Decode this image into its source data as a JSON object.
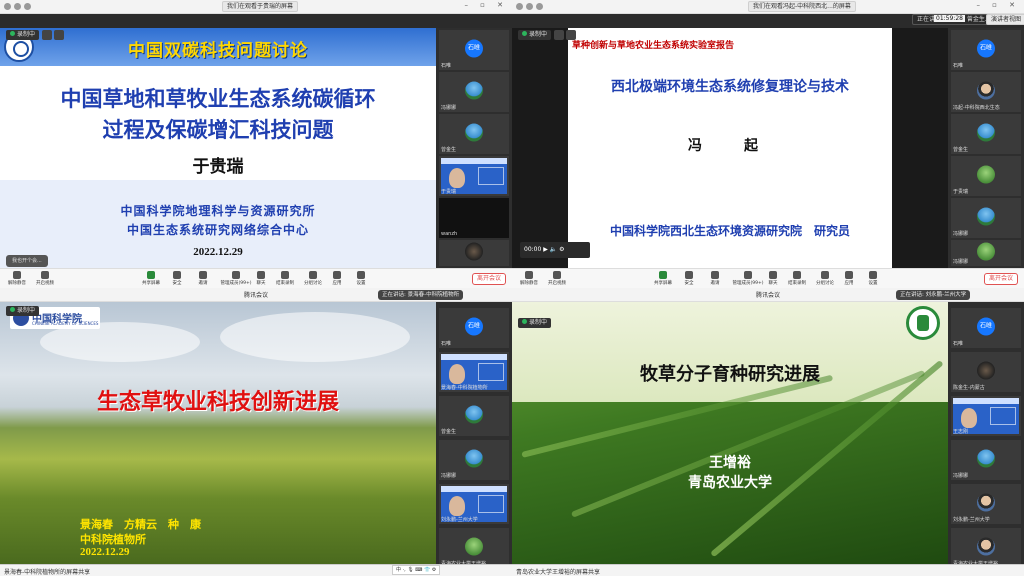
{
  "panels": [
    {
      "titlebar": {
        "speaking": "我们在观看于贵瑞的屏幕"
      },
      "recording": "录制中",
      "slide": {
        "header": "中国双碳科技问题讨论",
        "title_line1": "中国草地和草牧业生态系统碳循环",
        "title_line2": "过程及保碳增汇科技问题",
        "author": "于贵瑞",
        "org1": "中国科学院地理科学与资源研究所",
        "org2": "中国生态系统研究网络综合中心",
        "date": "2022.12.29",
        "speech": "我也开个会..."
      },
      "participants": [
        {
          "name": "石唯",
          "avatar_text": "石唯",
          "avatar": "logo"
        },
        {
          "name": "冯娜娜",
          "avatar": "sky"
        },
        {
          "name": "曾金生",
          "avatar": "sky"
        },
        {
          "name": "于贵瑞",
          "avatar": "slide"
        },
        {
          "name": "wanzh",
          "avatar": "dark"
        },
        {
          "name": "",
          "avatar": "dark"
        }
      ],
      "toolbar": [
        {
          "label": "解除静音",
          "icon": "mic-icon"
        },
        {
          "label": "开启视频",
          "icon": "camera-icon"
        },
        {
          "label": "共享屏幕",
          "icon": "share-screen-icon"
        },
        {
          "label": "安全",
          "icon": "shield-icon"
        },
        {
          "label": "邀请",
          "icon": "invite-icon"
        },
        {
          "label": "管理成员(99+)",
          "icon": "members-icon"
        },
        {
          "label": "聊天",
          "icon": "chat-icon"
        },
        {
          "label": "结束录制",
          "icon": "record-icon"
        },
        {
          "label": "分组讨论",
          "icon": "breakout-icon"
        },
        {
          "label": "应用",
          "icon": "apps-icon"
        },
        {
          "label": "设置",
          "icon": "gear-icon"
        }
      ],
      "leave": "离开会议"
    },
    {
      "titlebar": {
        "speaking": "正在讲话: 于贵瑞; 曾金生...",
        "center": "我们在观看冯起-中科院西北...的屏幕",
        "timer": "01:59:28",
        "layout": "演讲者视图"
      },
      "recording": "录制中",
      "slide": {
        "header": "草种创新与草地农业生态系统实验室报告",
        "title": "西北极端环境生态系统修复理论与技术",
        "author": "冯　起",
        "org": "中国科学院西北生态环境资源研究院　研究员",
        "player_time": "00:00"
      },
      "participants": [
        {
          "name": "石唯",
          "avatar_text": "石唯",
          "avatar": "logo"
        },
        {
          "name": "冯起-中科院西北生态",
          "avatar": "face"
        },
        {
          "name": "曾金生",
          "avatar": "sky"
        },
        {
          "name": "于贵瑞",
          "avatar": "grass"
        },
        {
          "name": "冯娜娜",
          "avatar": "sky"
        },
        {
          "name": "冯娜娜",
          "avatar": "grass"
        }
      ],
      "toolbar": [
        {
          "label": "解除静音",
          "icon": "mic-icon"
        },
        {
          "label": "开启视频",
          "icon": "camera-icon"
        },
        {
          "label": "共享屏幕",
          "icon": "share-screen-icon"
        },
        {
          "label": "安全",
          "icon": "shield-icon"
        },
        {
          "label": "邀请",
          "icon": "invite-icon"
        },
        {
          "label": "管理成员(99+)",
          "icon": "members-icon"
        },
        {
          "label": "聊天",
          "icon": "chat-icon"
        },
        {
          "label": "结束录制",
          "icon": "record-icon"
        },
        {
          "label": "分组讨论",
          "icon": "breakout-icon"
        },
        {
          "label": "应用",
          "icon": "apps-icon"
        },
        {
          "label": "设置",
          "icon": "gear-icon"
        }
      ],
      "leave": "离开会议"
    },
    {
      "titlebar": {
        "center": "腾讯会议",
        "speaking": "正在讲话: 景海春-中科院植物所"
      },
      "recording": "录制中",
      "slide": {
        "logo_cn": "中国科学院",
        "logo_en": "CHINESE ACADEMY OF SCIENCES",
        "title": "生态草牧业科技创新进展",
        "authors": "景海春　方精云　种　康",
        "inst": "中科院植物所",
        "date": "2022.12.29"
      },
      "participants": [
        {
          "name": "石唯",
          "avatar_text": "石唯",
          "avatar": "logo"
        },
        {
          "name": "景海春-中科院植物所",
          "avatar": "slide"
        },
        {
          "name": "曾金生",
          "avatar": "sky"
        },
        {
          "name": "冯娜娜",
          "avatar": "sky"
        },
        {
          "name": "刘永鹏-兰州大学",
          "avatar": "slide"
        },
        {
          "name": "青海农业大学王增裕",
          "avatar": "grass"
        }
      ],
      "bottom": "景海春-中科院植物所的屏幕共享"
    },
    {
      "titlebar": {
        "center": "腾讯会议",
        "speaking": "正在讲话: 刘永鹏-兰州大学"
      },
      "recording": "录制中",
      "slide": {
        "title": "牧草分子育种研究进展",
        "author": "王增裕",
        "university": "青岛农业大学"
      },
      "participants": [
        {
          "name": "石唯",
          "avatar_text": "石唯",
          "avatar": "logo"
        },
        {
          "name": "陈金生-内蒙古",
          "avatar": "dark"
        },
        {
          "name": "王志刚",
          "avatar": "slide"
        },
        {
          "name": "冯娜娜",
          "avatar": "sky"
        },
        {
          "name": "刘永鹏-兰州大学",
          "avatar": "face"
        },
        {
          "name": "青海农业大学王增裕",
          "avatar": "face"
        }
      ],
      "bottom": "青岛农业大学王增裕的屏幕共享"
    }
  ],
  "ime": "中 ·, 🎙 ⌨ 👕 ⚙"
}
